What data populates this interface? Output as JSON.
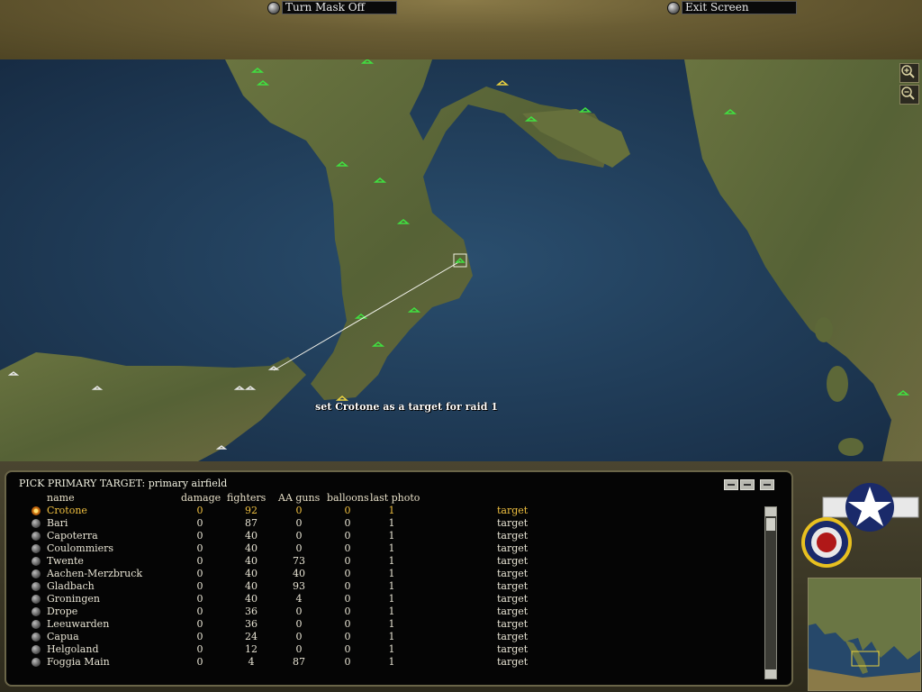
{
  "toolbar": {
    "mask_label": "Turn Mask Off",
    "exit_label": "Exit Screen"
  },
  "map": {
    "caption": "set Crotone as a target for raid 1",
    "zoom_in_icon": "magnify-plus-icon",
    "zoom_out_icon": "magnify-minus-icon"
  },
  "panel": {
    "title": "PICK PRIMARY TARGET: primary airfield",
    "columns": {
      "name": "name",
      "damage": "damage",
      "fighters": "fighters",
      "aa": "AA guns",
      "balloons": "balloons",
      "photo": "last photo"
    },
    "rows": [
      {
        "name": "Crotone",
        "damage": "0",
        "fighters": "92",
        "aa": "0",
        "balloons": "0",
        "photo": "1",
        "action": "target"
      },
      {
        "name": "Bari",
        "damage": "0",
        "fighters": "87",
        "aa": "0",
        "balloons": "0",
        "photo": "1",
        "action": "target"
      },
      {
        "name": "Capoterra",
        "damage": "0",
        "fighters": "40",
        "aa": "0",
        "balloons": "0",
        "photo": "1",
        "action": "target"
      },
      {
        "name": "Coulommiers",
        "damage": "0",
        "fighters": "40",
        "aa": "0",
        "balloons": "0",
        "photo": "1",
        "action": "target"
      },
      {
        "name": "Twente",
        "damage": "0",
        "fighters": "40",
        "aa": "73",
        "balloons": "0",
        "photo": "1",
        "action": "target"
      },
      {
        "name": "Aachen-Merzbruck",
        "damage": "0",
        "fighters": "40",
        "aa": "40",
        "balloons": "0",
        "photo": "1",
        "action": "target"
      },
      {
        "name": "Gladbach",
        "damage": "0",
        "fighters": "40",
        "aa": "93",
        "balloons": "0",
        "photo": "1",
        "action": "target"
      },
      {
        "name": "Groningen",
        "damage": "0",
        "fighters": "40",
        "aa": "4",
        "balloons": "0",
        "photo": "1",
        "action": "target"
      },
      {
        "name": "Drope",
        "damage": "0",
        "fighters": "36",
        "aa": "0",
        "balloons": "0",
        "photo": "1",
        "action": "target"
      },
      {
        "name": "Leeuwarden",
        "damage": "0",
        "fighters": "36",
        "aa": "0",
        "balloons": "0",
        "photo": "1",
        "action": "target"
      },
      {
        "name": "Capua",
        "damage": "0",
        "fighters": "24",
        "aa": "0",
        "balloons": "0",
        "photo": "1",
        "action": "target"
      },
      {
        "name": "Helgoland",
        "damage": "0",
        "fighters": "12",
        "aa": "0",
        "balloons": "0",
        "photo": "1",
        "action": "target"
      },
      {
        "name": "Foggia Main",
        "damage": "0",
        "fighters": "4",
        "aa": "87",
        "balloons": "0",
        "photo": "1",
        "action": "target"
      }
    ],
    "selected_index": 0
  },
  "colors": {
    "selected_row": "#f0c040",
    "airfield_marker": "#40e040",
    "target_marker": "#e8d040",
    "sea": "#1f3c5a",
    "land": "#5a6a38"
  }
}
